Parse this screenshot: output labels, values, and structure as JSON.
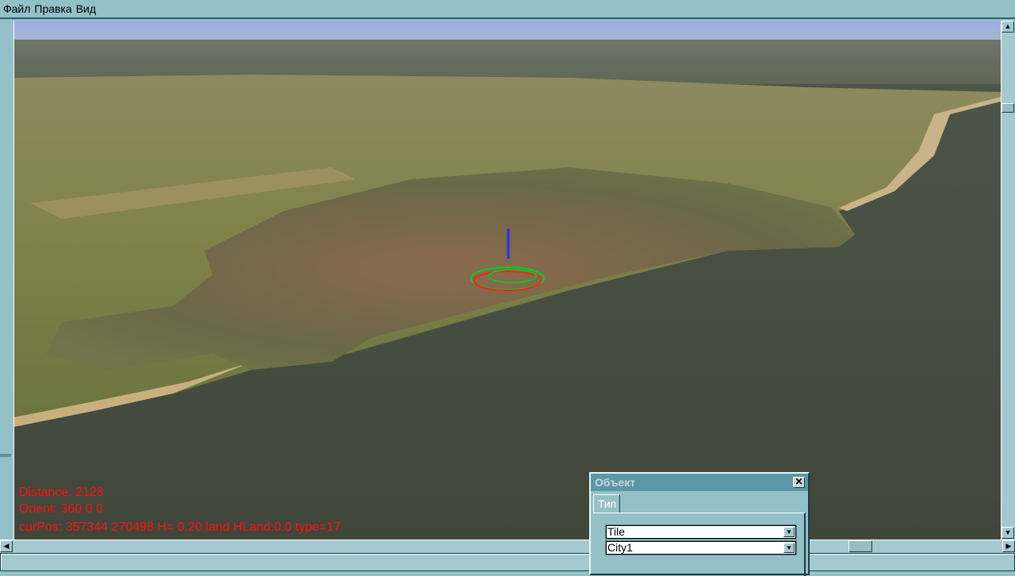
{
  "menu": [
    "Файл",
    "Правка",
    "Вид"
  ],
  "hud": {
    "distance": "Distance: 2128",
    "orient": "Orient: 360 0 0",
    "curpos": "curPos: 357344 270498 H= 0.20 land HLand:0.0 type=17"
  },
  "dialog": {
    "title": "Объект",
    "tab": "Тип",
    "type_value": "Tile",
    "name_value": "City1"
  },
  "icons": {
    "close": "close-icon",
    "dropdown": "chevron-down-icon"
  }
}
